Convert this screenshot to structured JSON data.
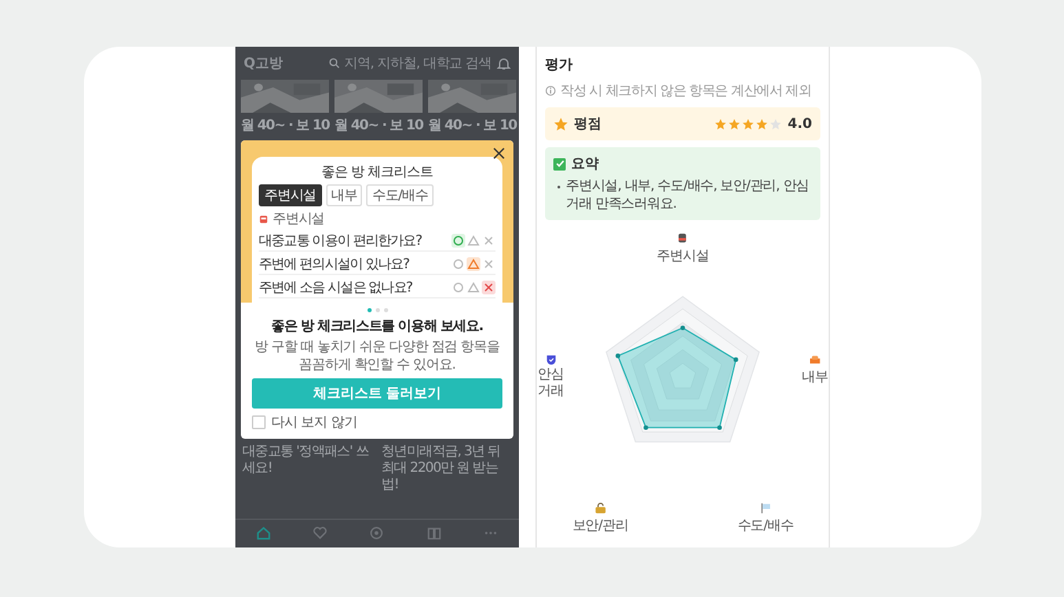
{
  "left_screen": {
    "header": {
      "logo": "Q고방",
      "search_placeholder": "지역, 지하철, 대학교 검색"
    },
    "listings": [
      {
        "price": "월 40~ · 보 10"
      },
      {
        "price": "월 40~ · 보 10"
      },
      {
        "price": "월 40~ · 보 10"
      }
    ],
    "modal": {
      "illustration": {
        "title": "좋은 방 체크리스트",
        "tabs": [
          {
            "label": "주변시설",
            "selected": true
          },
          {
            "label": "내부",
            "selected": false
          },
          {
            "label": "수도/배수",
            "selected": false
          }
        ],
        "section": "주변시설",
        "questions": [
          {
            "text": "대중교통 이용이 편리한가요?",
            "options": [
              {
                "kind": "circle",
                "selected": true
              },
              {
                "kind": "triangle",
                "selected": false
              },
              {
                "kind": "cross",
                "selected": false
              }
            ]
          },
          {
            "text": "주변에 편의시설이 있나요?",
            "options": [
              {
                "kind": "circle",
                "selected": false
              },
              {
                "kind": "triangle",
                "selected": true
              },
              {
                "kind": "cross",
                "selected": false
              }
            ]
          },
          {
            "text": "주변에 소음 시설은 없나요?",
            "options": [
              {
                "kind": "circle",
                "selected": false
              },
              {
                "kind": "triangle",
                "selected": false
              },
              {
                "kind": "cross",
                "selected": true
              }
            ]
          }
        ]
      },
      "page_dots": [
        {
          "selected": true
        },
        {
          "selected": false
        },
        {
          "selected": false
        }
      ],
      "title": "좋은 방 체크리스트를 이용해 보세요.",
      "description": "방 구할 때 놓치기 쉬운 다양한 점검 항목을 꼼꼼하게 확인할 수 있어요.",
      "button": "체크리스트 둘러보기",
      "dont_show_again": {
        "label": "다시 보지 않기",
        "checked": false
      }
    },
    "news_captions": [
      "대중교통 '정액패스' 쓰세요!",
      "청년미래적금, 3년 뒤 최대 2200만 원 받는 법!"
    ],
    "bottom_nav": [
      {
        "kind": "home",
        "selected": true
      },
      {
        "kind": "heart",
        "selected": false
      },
      {
        "kind": "pin",
        "selected": false
      },
      {
        "kind": "book",
        "selected": false
      },
      {
        "kind": "more",
        "selected": false
      }
    ]
  },
  "right_screen": {
    "section_title": "평가",
    "note": "작성 시 체크하지 않은 항목은 계산에서 제외",
    "rating": {
      "label": "평점",
      "stars": 4,
      "value": "4.0"
    },
    "summary": {
      "title": "요약",
      "checked": true,
      "items": [
        "주변시설, 내부, 수도/배수, 보안/관리, 안심거래 만족스러워요."
      ]
    },
    "radar_axes": [
      {
        "label": "주변시설",
        "kind": "facility"
      },
      {
        "label": "내부",
        "kind": "interior"
      },
      {
        "label": "수도/배수",
        "kind": "plumbing"
      },
      {
        "label": "보안/관리",
        "kind": "security"
      },
      {
        "label": "안심거래",
        "kind": "safe"
      }
    ]
  }
}
